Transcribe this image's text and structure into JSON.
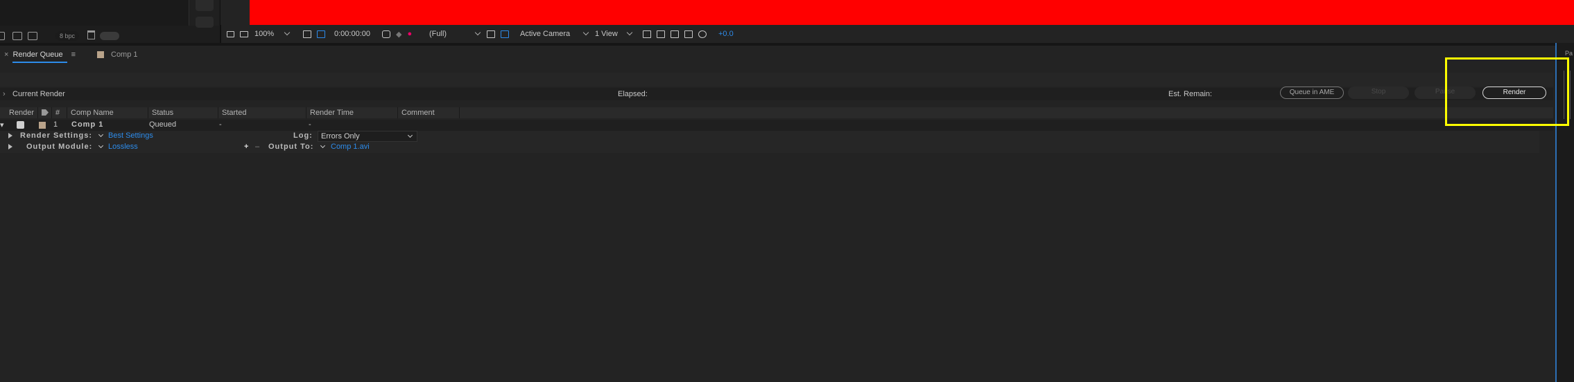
{
  "toolbar_left": {
    "bpc": "8 bpc"
  },
  "viewer_bar": {
    "zoom": "100%",
    "timecode": "0:00:00:00",
    "resolution": "(Full)",
    "camera": "Active Camera",
    "views": "1 View",
    "exposure": "+0.0"
  },
  "tabs": [
    {
      "label": "Render Queue"
    },
    {
      "label": "Comp 1"
    }
  ],
  "current_render": {
    "label": "Current Render",
    "elapsed": "Elapsed:",
    "est_remain": "Est. Remain:"
  },
  "buttons": {
    "queue_in_ame": "Queue in AME",
    "stop": "Stop",
    "pause": "Pause",
    "render": "Render"
  },
  "columns": [
    "Render",
    "#",
    "Comp Name",
    "Status",
    "Started",
    "Render Time",
    "Comment"
  ],
  "queue_item": {
    "number": "1",
    "comp_name": "Comp 1",
    "status": "Queued",
    "started": "-",
    "render_time": "-",
    "render_settings_label": "Render Settings:",
    "render_settings_value": "Best Settings",
    "log_label": "Log:",
    "log_value": "Errors Only",
    "output_module_label": "Output Module:",
    "output_module_value": "Lossless",
    "output_to_label": "Output To:",
    "output_to_value": "Comp 1.avi"
  },
  "right_panel": {
    "label": "Pa"
  },
  "colors": {
    "accent": "#2d8ceb",
    "viewer": "#ff0000",
    "highlight": "#ffff00"
  }
}
